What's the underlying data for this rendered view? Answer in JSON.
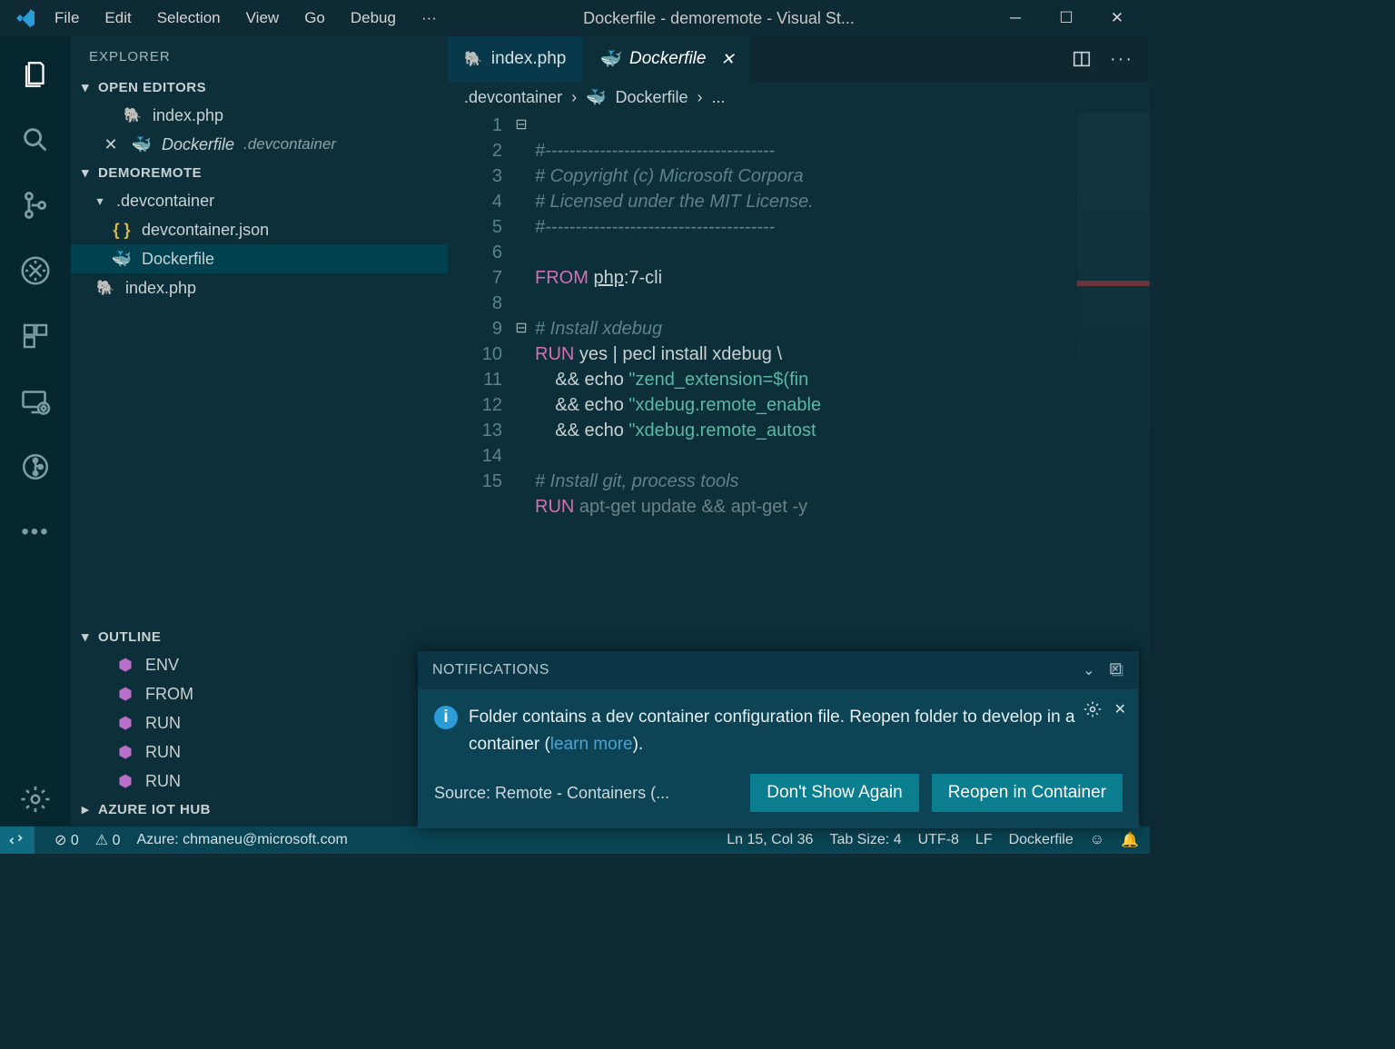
{
  "window": {
    "title": "Dockerfile - demoremote - Visual St..."
  },
  "menu": [
    "File",
    "Edit",
    "Selection",
    "View",
    "Go",
    "Debug",
    "···"
  ],
  "sidebar": {
    "title": "EXPLORER",
    "open_editors": {
      "header": "OPEN EDITORS",
      "items": [
        {
          "icon": "php",
          "label": "index.php"
        },
        {
          "icon": "close-docker",
          "label": "Dockerfile",
          "suffix": ".devcontainer"
        }
      ]
    },
    "workspace": {
      "header": "DEMOREMOTE",
      "items": [
        {
          "icon": "chev-folder",
          "label": ".devcontainer",
          "depth": 0
        },
        {
          "icon": "json",
          "label": "devcontainer.json",
          "depth": 1
        },
        {
          "icon": "docker",
          "label": "Dockerfile",
          "depth": 1,
          "selected": true
        },
        {
          "icon": "php",
          "label": "index.php",
          "depth": 0
        }
      ]
    },
    "outline": {
      "header": "OUTLINE",
      "items": [
        "ENV",
        "FROM",
        "RUN",
        "RUN",
        "RUN"
      ]
    },
    "azure": {
      "header": "AZURE IOT HUB"
    }
  },
  "tabs": [
    {
      "icon": "php",
      "label": "index.php",
      "active": false
    },
    {
      "icon": "docker",
      "label": "Dockerfile",
      "active": true,
      "closeable": true
    }
  ],
  "breadcrumb": [
    ".devcontainer",
    "Dockerfile",
    "..."
  ],
  "code": {
    "lines": [
      {
        "n": 1,
        "t": "#--------------------------------------"
      },
      {
        "n": 2,
        "t": "# Copyright (c) Microsoft Corpora"
      },
      {
        "n": 3,
        "t": "# Licensed under the MIT License."
      },
      {
        "n": 4,
        "t": "#--------------------------------------"
      },
      {
        "n": 5,
        "t": ""
      },
      {
        "n": 6,
        "t": "FROM php:7-cli"
      },
      {
        "n": 7,
        "t": ""
      },
      {
        "n": 8,
        "t": "# Install xdebug"
      },
      {
        "n": 9,
        "t": "RUN yes | pecl install xdebug \\"
      },
      {
        "n": 10,
        "t": "    && echo \"zend_extension=$(fin"
      },
      {
        "n": 11,
        "t": "    && echo \"xdebug.remote_enable"
      },
      {
        "n": 12,
        "t": "    && echo \"xdebug.remote_autost"
      },
      {
        "n": 13,
        "t": ""
      },
      {
        "n": 14,
        "t": "# Install git, process tools"
      },
      {
        "n": 15,
        "t": "RUN apt-get update && apt-get -y"
      }
    ]
  },
  "notification": {
    "header": "NOTIFICATIONS",
    "message_pre": "Folder contains a dev container configuration file. Reopen folder to develop in a container (",
    "message_link": "learn more",
    "message_post": ").",
    "source": "Source: Remote - Containers (...",
    "btn_dismiss": "Don't Show Again",
    "btn_reopen": "Reopen in Container"
  },
  "status": {
    "errors": "0",
    "warnings": "0",
    "azure": "Azure: chmaneu@microsoft.com",
    "position": "Ln 15, Col 36",
    "tabsize": "Tab Size: 4",
    "encoding": "UTF-8",
    "eol": "LF",
    "lang": "Dockerfile"
  }
}
